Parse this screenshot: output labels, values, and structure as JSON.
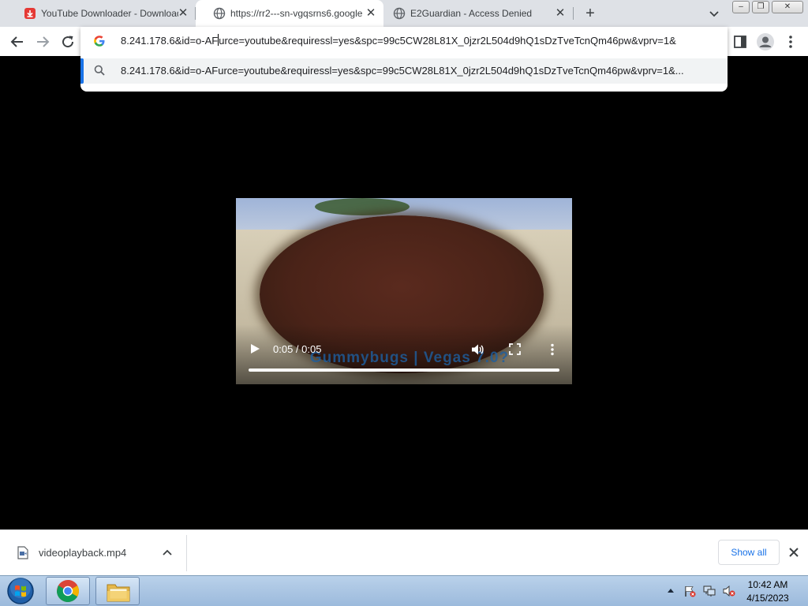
{
  "tabs": [
    {
      "title": "YouTube Downloader - Download",
      "favicon": "download-icon",
      "favicon_color": "#e53935",
      "active": false
    },
    {
      "title": "https://rr2---sn-vgqsrns6.google",
      "favicon": "globe-icon",
      "active": true
    },
    {
      "title": "E2Guardian - Access Denied",
      "favicon": "globe-icon",
      "active": false
    }
  ],
  "tab_close_glyph": "✕",
  "new_tab_glyph": "+",
  "window_controls": {
    "minimize": "–",
    "restore": "❐",
    "close": "✕"
  },
  "omnibox": {
    "text_before_caret": "8.241.178.6&id=o-AF",
    "text_after_caret": "urce=youtube&requiressl=yes&spc=99c5CW28L81X_0jzr2L504d9hQ1sDzTveTcnQm46pw&vprv=1&",
    "suggestion": "8.241.178.6&id=o-AFurce=youtube&requiressl=yes&spc=99c5CW28L81X_0jzr2L504d9hQ1sDzTveTcnQm46pw&vprv=1&..."
  },
  "video": {
    "time": "0:05 / 0:05",
    "caption": "Gummybugs | Vegas 7.0?",
    "progress": 1.0
  },
  "downloads": {
    "file_name": "videoplayback.mp4",
    "show_all_label": "Show all"
  },
  "taskbar": {
    "time": "10:42 AM",
    "date": "4/15/2023"
  },
  "colors": {
    "accent": "#1a73e8",
    "tab_strip": "#dee1e6",
    "taskbar": "#9cbadc"
  }
}
